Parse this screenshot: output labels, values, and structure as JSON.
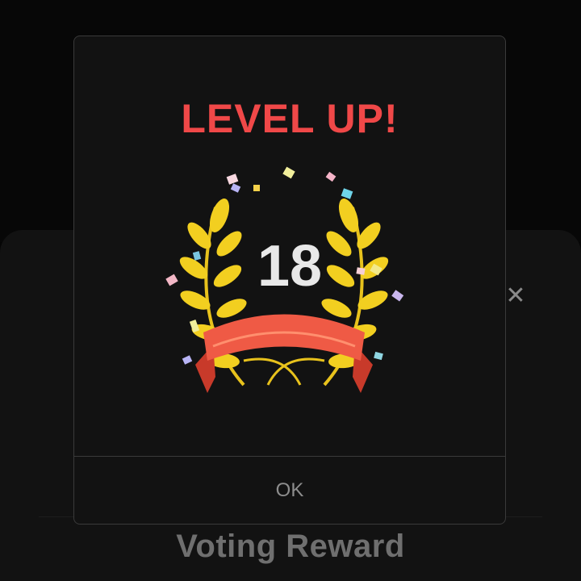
{
  "background": {
    "title": "Voting Reward",
    "close_icon": "close-icon",
    "close_glyph": "✕"
  },
  "modal": {
    "title": "LEVEL UP!",
    "level": "18",
    "ok_label": "OK",
    "title_color": "#f04848",
    "wreath_icon": "laurel-wreath-icon"
  }
}
